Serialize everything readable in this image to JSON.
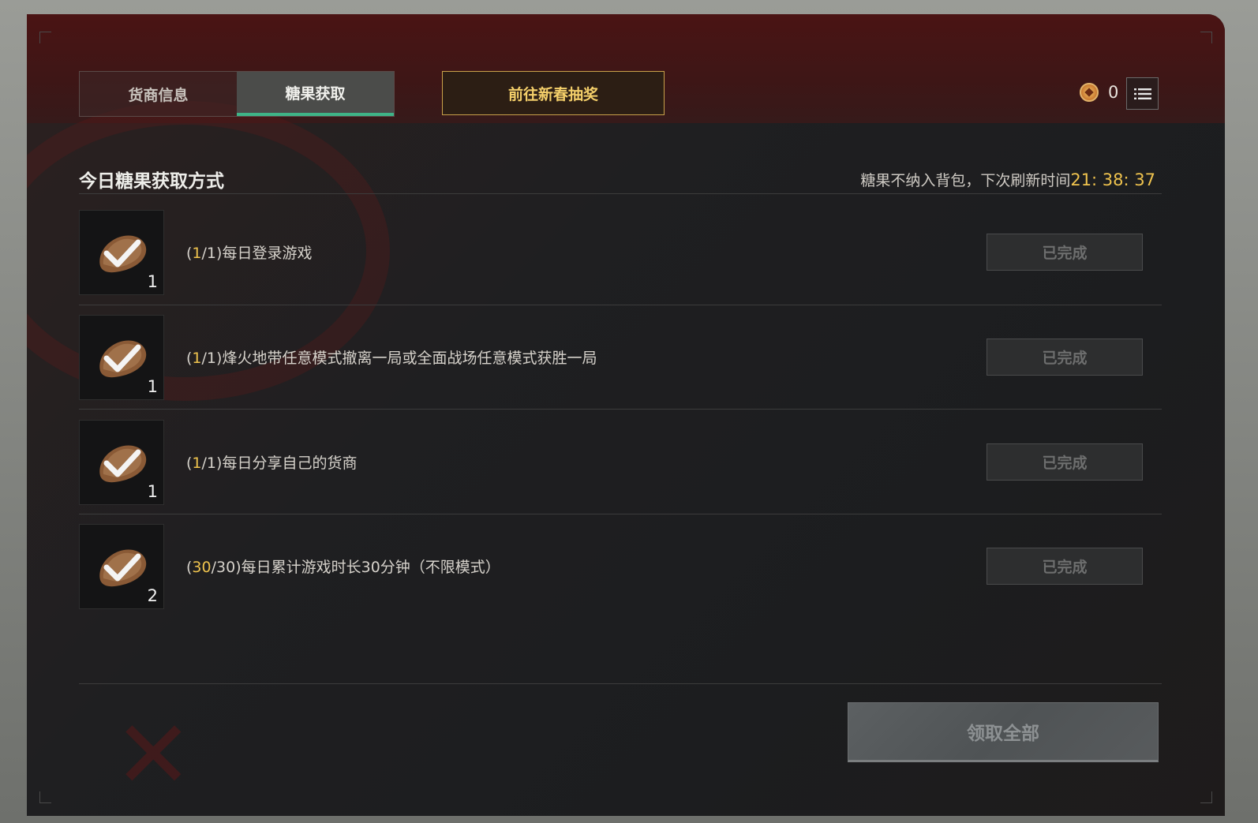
{
  "tabs": [
    {
      "label": "货商信息",
      "active": false
    },
    {
      "label": "糖果获取",
      "active": true
    }
  ],
  "lottery_button": "前往新春抽奖",
  "currency": {
    "count": "0",
    "icon": "coin-icon"
  },
  "section": {
    "title": "今日糖果获取方式",
    "refresh_prefix": "糖果不纳入背包，下次刷新时间",
    "refresh_time": "21: 38: 37"
  },
  "tasks": [
    {
      "icon": "candy-check-icon",
      "qty": "1",
      "progress": "1",
      "total": "1",
      "text": "每日登录游戏",
      "button": "已完成"
    },
    {
      "icon": "candy-check-icon",
      "qty": "1",
      "progress": "1",
      "total": "1",
      "text": "烽火地带任意模式撤离一局或全面战场任意模式获胜一局",
      "button": "已完成"
    },
    {
      "icon": "candy-check-icon",
      "qty": "1",
      "progress": "1",
      "total": "1",
      "text": "每日分享自己的货商",
      "button": "已完成"
    },
    {
      "icon": "candy-check-icon",
      "qty": "2",
      "progress": "30",
      "total": "30",
      "text": "每日累计游戏时长30分钟（不限模式）",
      "button": "已完成"
    }
  ],
  "claim_all_button": "领取全部",
  "colors": {
    "accent_green": "#3fb487",
    "accent_gold": "#efc34e",
    "header_red": "#4a1414"
  }
}
